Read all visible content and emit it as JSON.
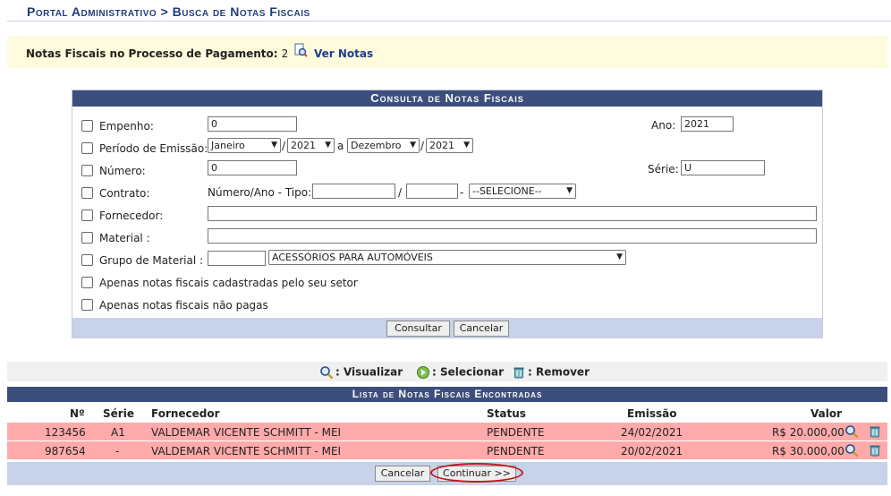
{
  "page_title": "Portal Administrativo > Busca de Notas Fiscais",
  "info": {
    "label": "Notas Fiscais no Processo de Pagamento:",
    "count": "2",
    "link": "Ver Notas"
  },
  "form": {
    "header": "Consulta de Notas Fiscais",
    "empenho_label": "Empenho:",
    "empenho_value": "0",
    "ano_label": "Ano:",
    "ano_value": "2021",
    "periodo_label": "Período de Emissão:",
    "mes_inicio": "Janeiro",
    "ano_inicio": "2021",
    "periodo_sep": "a",
    "mes_fim": "Dezembro",
    "ano_fim": "2021",
    "slash": "/",
    "numero_label": "Número:",
    "numero_value": "0",
    "serie_label": "Série:",
    "serie_value": "U",
    "contrato_label": "Contrato:",
    "contrato_hint": "Número/Ano - Tipo:",
    "contrato_dash": "-",
    "contrato_tipo": "--SELECIONE--",
    "fornecedor_label": "Fornecedor:",
    "material_label": "Material :",
    "grupo_label": "Grupo de Material :",
    "grupo_value": "ACESSÓRIOS PARA AUTOMÓVEIS",
    "setor_label": "Apenas notas fiscais cadastradas pelo seu setor",
    "nao_pagas_label": "Apenas notas fiscais não pagas",
    "consultar": "Consultar",
    "cancelar": "Cancelar"
  },
  "legend": {
    "visualizar": ": Visualizar",
    "selecionar": ": Selecionar",
    "remover": ": Remover"
  },
  "list": {
    "header": "Lista de Notas Fiscais Encontradas",
    "columns": [
      "Nº",
      "Série",
      "Fornecedor",
      "Status",
      "Emissão",
      "Valor"
    ],
    "rows": [
      {
        "numero": "123456",
        "serie": "A1",
        "fornecedor": "VALDEMAR VICENTE SCHMITT - MEI",
        "status": "PENDENTE",
        "emissao": "24/02/2021",
        "valor": "R$ 20.000,00"
      },
      {
        "numero": "987654",
        "serie": "-",
        "fornecedor": "VALDEMAR VICENTE SCHMITT - MEI",
        "status": "PENDENTE",
        "emissao": "20/02/2021",
        "valor": "R$ 30.000,00"
      }
    ],
    "cancelar": "Cancelar",
    "continuar": "Continuar >>"
  },
  "colors": {
    "header_bg": "#3c4f7c",
    "row_bg": "#ffaaaa",
    "highlight": "#c4121c"
  }
}
